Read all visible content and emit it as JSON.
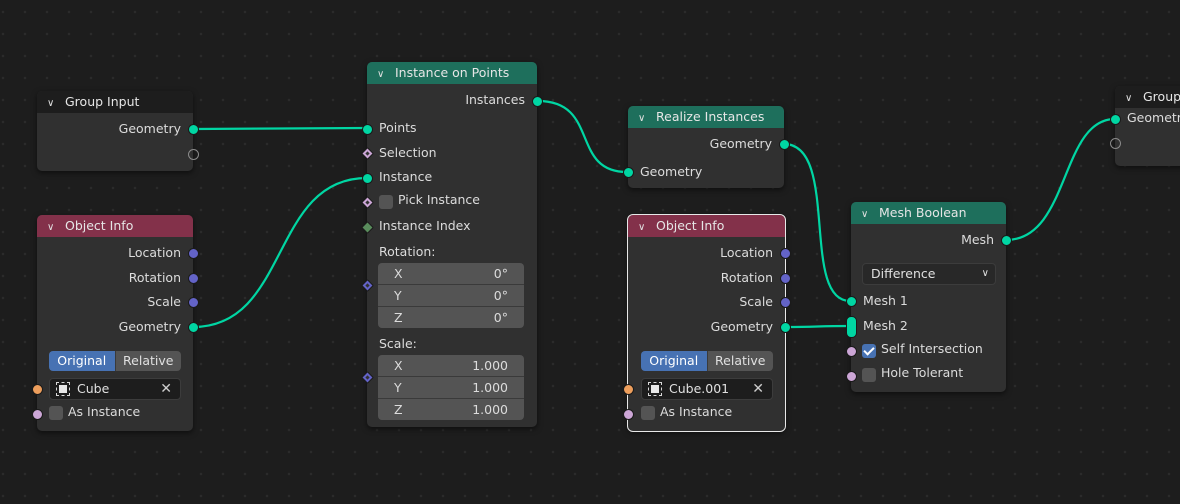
{
  "editor": "Geometry Nodes",
  "colors": {
    "background": "#1d1d1d",
    "node_body": "#303030",
    "header_geometry": "#1e6f5c",
    "header_input": "#83314a",
    "header_group": "#1d1d1d",
    "socket_geometry": "#00d6a3",
    "socket_vector": "#6363c7",
    "socket_object": "#ed9e5c",
    "socket_boolean": "#cca6d6",
    "socket_integer": "#598c5c",
    "link": "#00d6a3",
    "accent": "#4772b3"
  },
  "nodes": {
    "group_input": {
      "title": "Group Input",
      "outputs": [
        "Geometry"
      ]
    },
    "object_info_1": {
      "title": "Object Info",
      "outputs": [
        "Location",
        "Rotation",
        "Scale",
        "Geometry"
      ],
      "transform_space": {
        "options": [
          "Original",
          "Relative"
        ],
        "selected": "Original"
      },
      "object": "Cube",
      "as_instance_label": "As Instance",
      "as_instance": false
    },
    "instance_on_points": {
      "title": "Instance on Points",
      "outputs": [
        "Instances"
      ],
      "inputs": [
        "Points",
        "Selection",
        "Instance",
        "Pick Instance",
        "Instance Index"
      ],
      "pick_instance": false,
      "rotation_label": "Rotation:",
      "rotation": [
        {
          "axis": "X",
          "value": "0°"
        },
        {
          "axis": "Y",
          "value": "0°"
        },
        {
          "axis": "Z",
          "value": "0°"
        }
      ],
      "scale_label": "Scale:",
      "scale": [
        {
          "axis": "X",
          "value": "1.000"
        },
        {
          "axis": "Y",
          "value": "1.000"
        },
        {
          "axis": "Z",
          "value": "1.000"
        }
      ]
    },
    "realize_instances": {
      "title": "Realize Instances",
      "outputs": [
        "Geometry"
      ],
      "inputs": [
        "Geometry"
      ]
    },
    "object_info_2": {
      "title": "Object Info",
      "outputs": [
        "Location",
        "Rotation",
        "Scale",
        "Geometry"
      ],
      "transform_space": {
        "options": [
          "Original",
          "Relative"
        ],
        "selected": "Original"
      },
      "object": "Cube.001",
      "as_instance_label": "As Instance",
      "as_instance": false
    },
    "mesh_boolean": {
      "title": "Mesh Boolean",
      "outputs": [
        "Mesh"
      ],
      "operation": "Difference",
      "inputs": [
        "Mesh 1",
        "Mesh 2",
        "Self Intersection",
        "Hole Tolerant"
      ],
      "self_intersection": true,
      "hole_tolerant": false
    },
    "group_output": {
      "title": "Group",
      "inputs": [
        "Geometry"
      ]
    }
  }
}
